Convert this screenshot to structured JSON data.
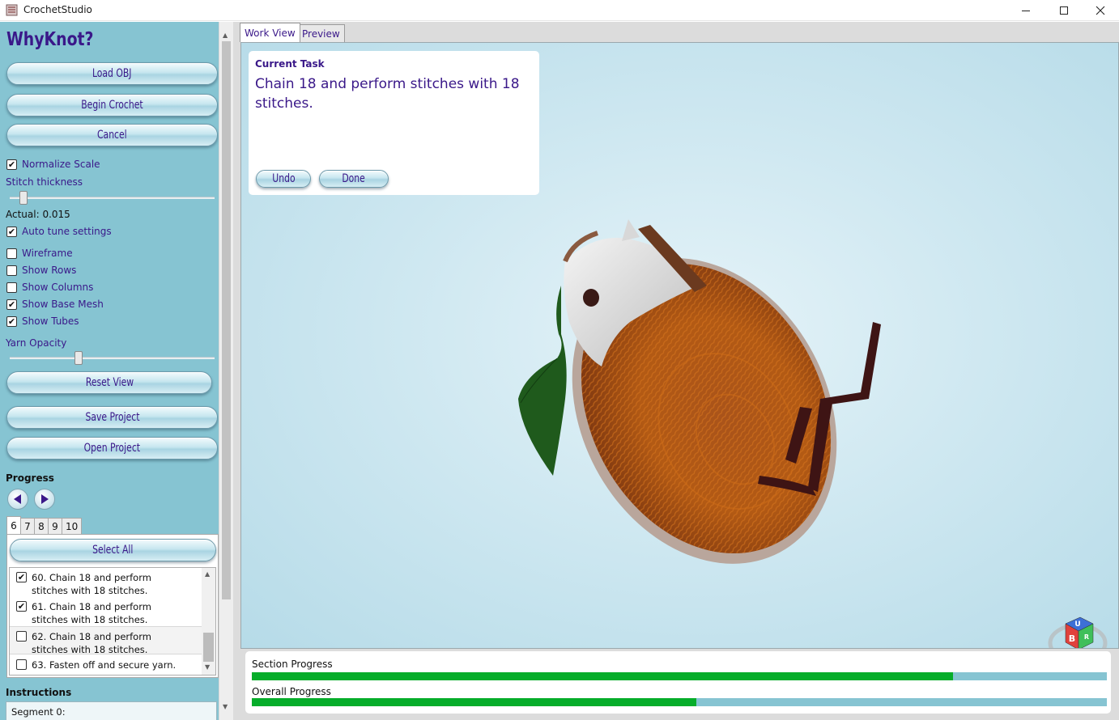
{
  "window": {
    "title": "CrochetStudio"
  },
  "sidebar": {
    "brand": "WhyKnot?",
    "load_obj": "Load OBJ",
    "begin_crochet": "Begin Crochet",
    "cancel": "Cancel",
    "normalize_scale": {
      "label": "Normalize Scale",
      "checked": true
    },
    "stitch_thickness_label": "Stitch thickness",
    "stitch_thickness_level": 0.05,
    "actual_label": "Actual: 0.015",
    "auto_tune": {
      "label": "Auto tune settings",
      "checked": true
    },
    "wireframe": {
      "label": "Wireframe",
      "checked": false
    },
    "show_rows": {
      "label": "Show Rows",
      "checked": false
    },
    "show_columns": {
      "label": "Show Columns",
      "checked": false
    },
    "show_base_mesh": {
      "label": "Show Base Mesh",
      "checked": true
    },
    "show_tubes": {
      "label": "Show Tubes",
      "checked": true
    },
    "yarn_opacity_label": "Yarn Opacity",
    "yarn_opacity_level": 0.33,
    "reset_view": "Reset View",
    "save_project": "Save Project",
    "open_project": "Open Project",
    "progress_heading": "Progress",
    "section_tabs": [
      "6",
      "7",
      "8",
      "9",
      "10"
    ],
    "active_section_tab": "6",
    "select_all": "Select All",
    "steps": [
      {
        "text": "60. Chain 18 and perform stitches with 18 stitches.",
        "checked": true
      },
      {
        "text": "61. Chain 18 and perform stitches with 18 stitches.",
        "checked": true
      },
      {
        "text": "62. Chain 18 and perform stitches with 18 stitches.",
        "checked": false
      },
      {
        "text": "63. Fasten off and secure yarn.",
        "checked": false
      }
    ],
    "instructions_heading": "Instructions",
    "instructions_text": "Segment 0:"
  },
  "main": {
    "tabs": [
      "Work View",
      "Preview"
    ],
    "active_tab": "Work View",
    "task_card": {
      "title": "Current Task",
      "text": "Chain 18 and perform stitches with 18 stitches.",
      "undo": "Undo",
      "done": "Done"
    },
    "view_cube": {
      "faces": [
        "U",
        "B",
        "R"
      ],
      "colors": [
        "#3d6fd6",
        "#e0413c",
        "#3fbf5a"
      ]
    },
    "section_progress": {
      "label": "Section Progress",
      "value": 0.82
    },
    "overall_progress": {
      "label": "Overall Progress",
      "value": 0.52
    }
  },
  "colors": {
    "accent_text": "#3a1889",
    "panel": "#86c4d2",
    "progress_fill": "#06ad2a"
  }
}
